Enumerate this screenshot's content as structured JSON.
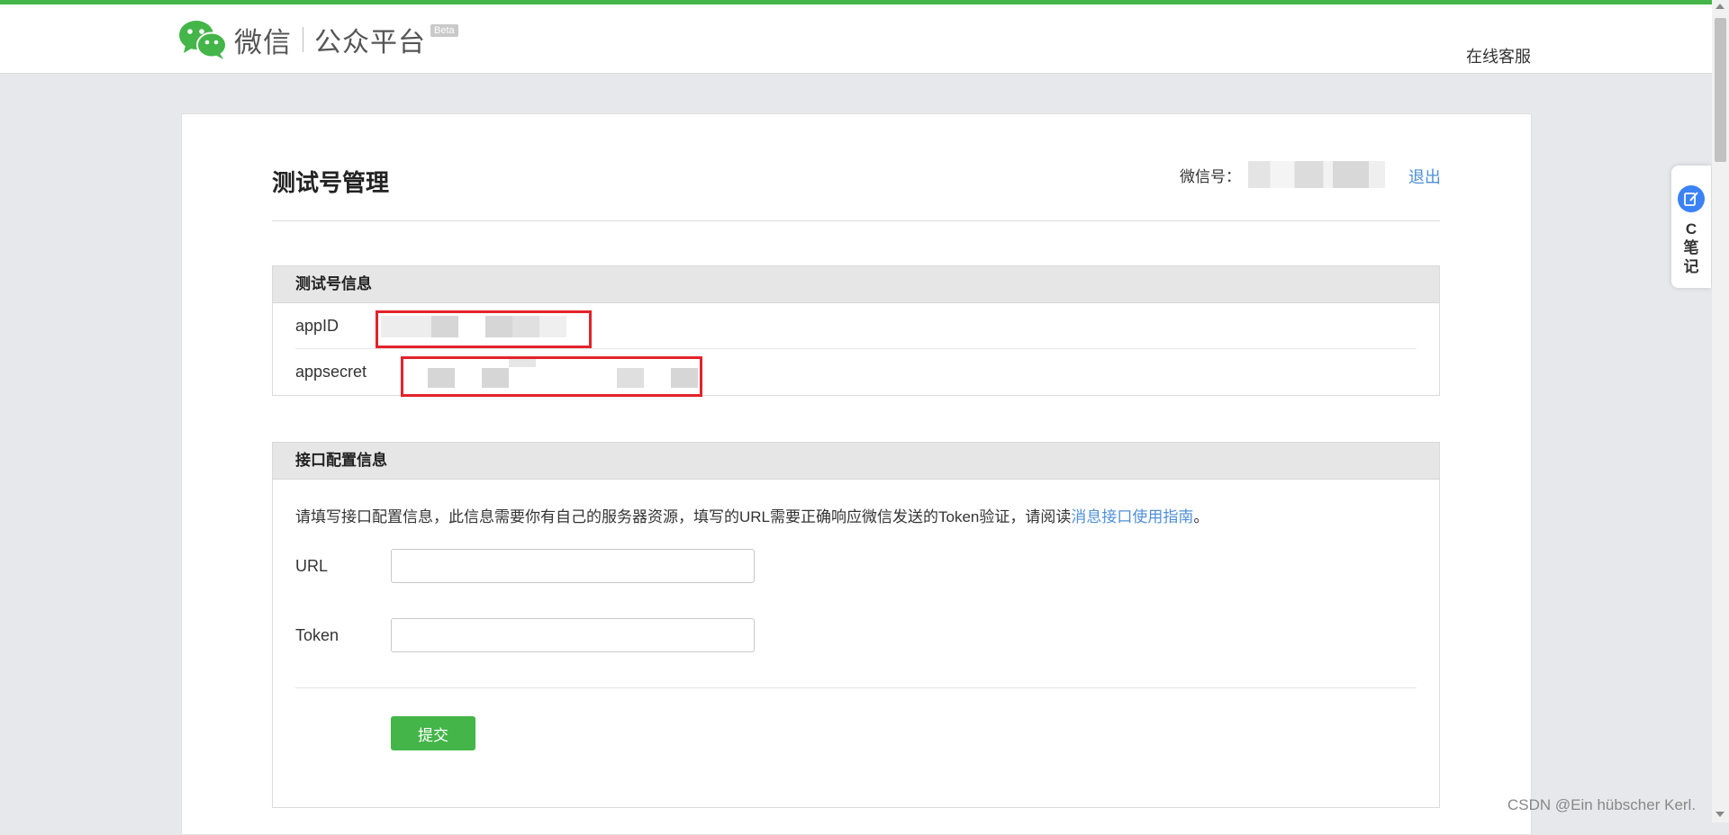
{
  "colors": {
    "brand_green": "#44b549",
    "link_blue": "#4f8fd6",
    "highlight_red": "#e3232a",
    "page_bg": "#e7e8eb"
  },
  "header": {
    "logo_main": "微信",
    "logo_sub": "公众平台",
    "logo_badge": "Beta",
    "online_service": "在线客服"
  },
  "page": {
    "title": "测试号管理",
    "account_label": "微信号：",
    "logout": "退出"
  },
  "test_account_panel": {
    "title": "测试号信息",
    "rows": [
      {
        "label": "appID"
      },
      {
        "label": "appsecret"
      }
    ]
  },
  "interface_panel": {
    "title": "接口配置信息",
    "description": "请填写接口配置信息，此信息需要你有自己的服务器资源，填写的URL需要正确响应微信发送的Token验证，请阅读",
    "link_text": "消息接口使用指南",
    "period": "。",
    "fields": [
      {
        "label": "URL",
        "value": ""
      },
      {
        "label": "Token",
        "value": ""
      }
    ],
    "submit": "提交"
  },
  "side_widget": {
    "text": "C笔记",
    "icon": "note-edit-icon"
  },
  "watermark": "CSDN @Ein hübscher Kerl."
}
